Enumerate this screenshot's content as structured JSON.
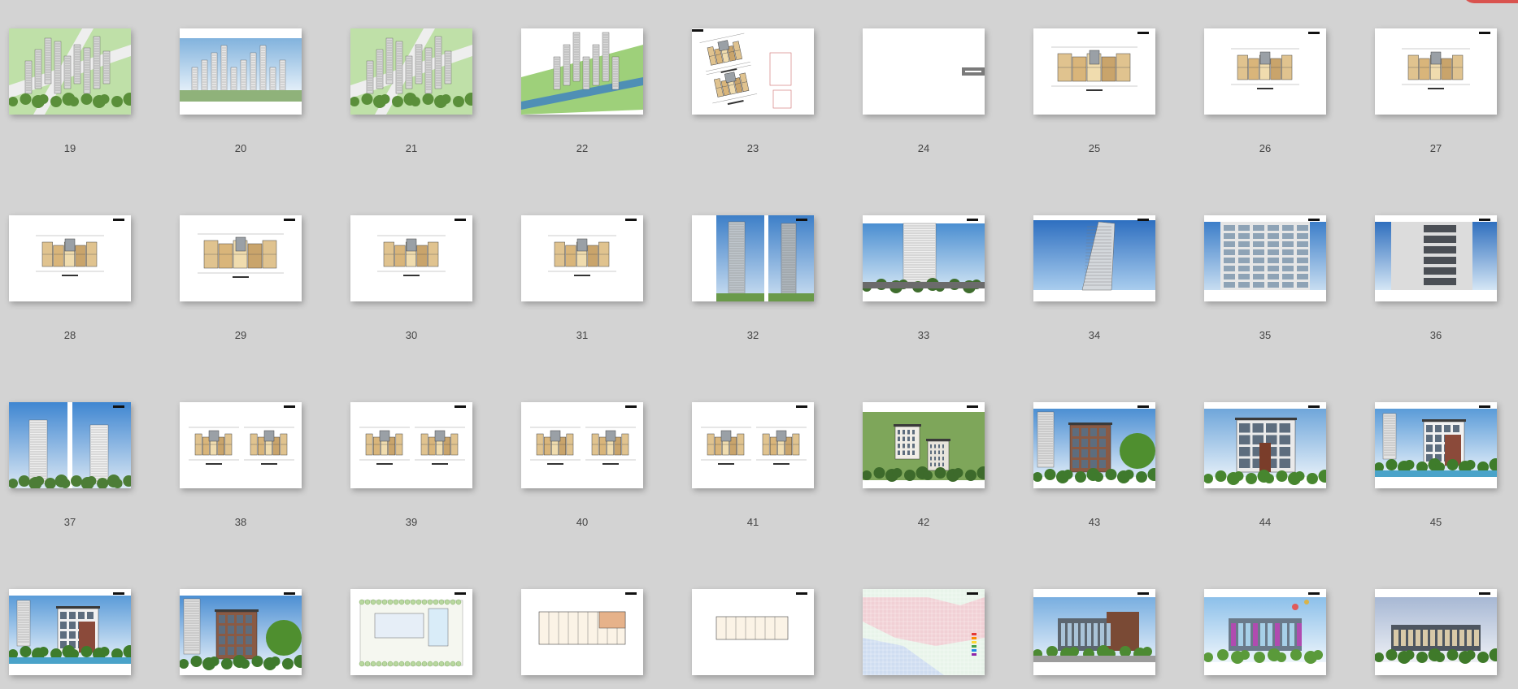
{
  "window": {
    "corner_color": "#d9534f"
  },
  "pages": [
    {
      "number": "19",
      "kind": "aerial"
    },
    {
      "number": "20",
      "kind": "skyline"
    },
    {
      "number": "21",
      "kind": "aerial"
    },
    {
      "number": "22",
      "kind": "aerial-water"
    },
    {
      "number": "23",
      "kind": "multi-plan"
    },
    {
      "number": "24",
      "kind": "blank"
    },
    {
      "number": "25",
      "kind": "floorplan-wide"
    },
    {
      "number": "26",
      "kind": "floorplan"
    },
    {
      "number": "27",
      "kind": "floorplan"
    },
    {
      "number": "28",
      "kind": "floorplan"
    },
    {
      "number": "29",
      "kind": "floorplan-wide"
    },
    {
      "number": "30",
      "kind": "floorplan"
    },
    {
      "number": "31",
      "kind": "floorplan"
    },
    {
      "number": "32",
      "kind": "twin-tower"
    },
    {
      "number": "33",
      "kind": "street"
    },
    {
      "number": "34",
      "kind": "tower-sky"
    },
    {
      "number": "35",
      "kind": "facade"
    },
    {
      "number": "36",
      "kind": "facade-glass"
    },
    {
      "number": "37",
      "kind": "twin-tower-white"
    },
    {
      "number": "38",
      "kind": "double-plan"
    },
    {
      "number": "39",
      "kind": "double-plan"
    },
    {
      "number": "40",
      "kind": "double-plan"
    },
    {
      "number": "41",
      "kind": "double-plan"
    },
    {
      "number": "42",
      "kind": "villa-aerial"
    },
    {
      "number": "43",
      "kind": "villa"
    },
    {
      "number": "44",
      "kind": "villa-front"
    },
    {
      "number": "45",
      "kind": "villa-water"
    },
    {
      "number": "",
      "kind": "villa-water"
    },
    {
      "number": "",
      "kind": "villa"
    },
    {
      "number": "",
      "kind": "site-plan"
    },
    {
      "number": "",
      "kind": "long-plan"
    },
    {
      "number": "",
      "kind": "long-plan-small"
    },
    {
      "number": "",
      "kind": "grid-map"
    },
    {
      "number": "",
      "kind": "club"
    },
    {
      "number": "",
      "kind": "club-balloon"
    },
    {
      "number": "",
      "kind": "club-dusk"
    }
  ]
}
